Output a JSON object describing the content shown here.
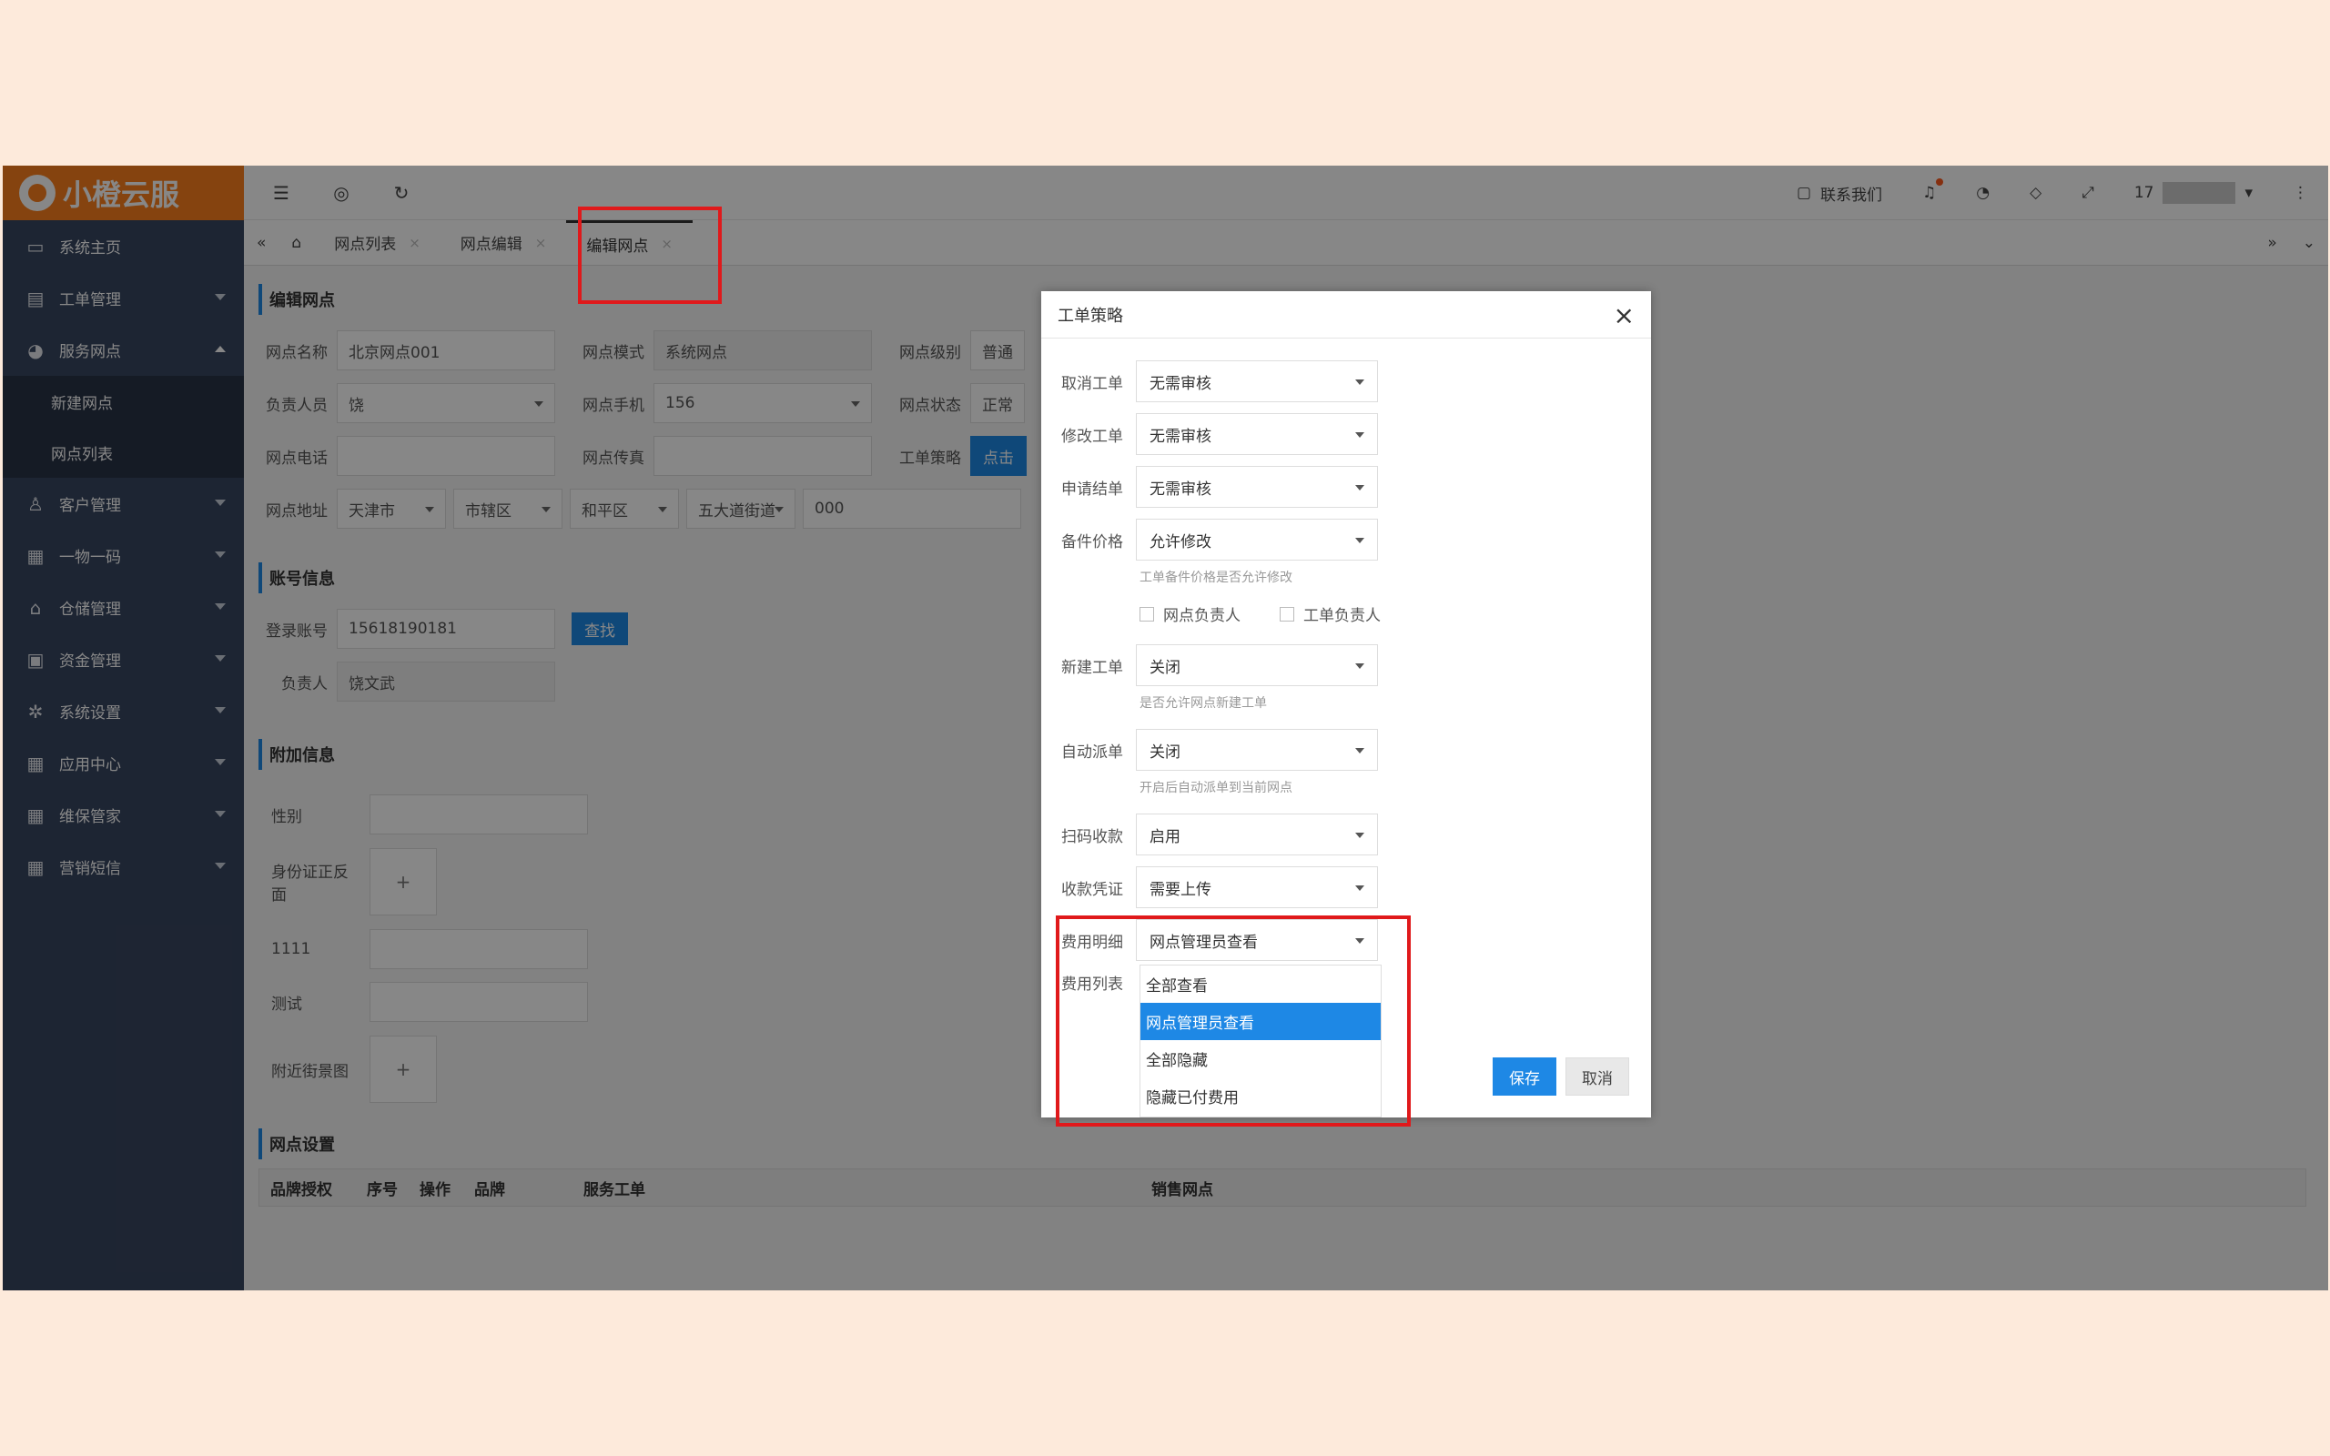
{
  "brand": {
    "name": "小橙云服",
    "color": "#fb7f1d"
  },
  "sidebar": {
    "items": [
      {
        "label": "系统主页",
        "icon": "monitor-icon"
      },
      {
        "label": "工单管理",
        "icon": "document-icon"
      },
      {
        "label": "服务网点",
        "icon": "globe-icon",
        "expanded": true,
        "children": [
          "新建网点",
          "网点列表"
        ]
      },
      {
        "label": "客户管理",
        "icon": "user-icon"
      },
      {
        "label": "一物一码",
        "icon": "grid-icon"
      },
      {
        "label": "仓储管理",
        "icon": "bank-icon"
      },
      {
        "label": "资金管理",
        "icon": "money-icon"
      },
      {
        "label": "系统设置",
        "icon": "gear-icon"
      },
      {
        "label": "应用中心",
        "icon": "grid-icon"
      },
      {
        "label": "维保管家",
        "icon": "grid-icon"
      },
      {
        "label": "营销短信",
        "icon": "grid-icon"
      }
    ]
  },
  "topbar": {
    "contact": "联系我们",
    "user": "17"
  },
  "tabs": [
    "网点列表",
    "网点编辑",
    "编辑网点"
  ],
  "form": {
    "section1": "编辑网点",
    "name_label": "网点名称",
    "name_value": "北京网点001",
    "mode_label": "网点模式",
    "mode_value": "系统网点",
    "level_label": "网点级别",
    "level_value": "普通",
    "owner_label": "负责人员",
    "owner_value": "饶",
    "phone_label": "网点手机",
    "phone_value": "156",
    "status_label": "网点状态",
    "status_value": "正常",
    "tel_label": "网点电话",
    "fax_label": "网点传真",
    "strategy_label": "工单策略",
    "strategy_btn": "点击",
    "addr_label": "网点地址",
    "addr_city": "天津市",
    "addr_district": "市辖区",
    "addr_area": "和平区",
    "addr_street": "五大道街道",
    "addr_detail": "000",
    "section2": "账号信息",
    "login_label": "登录账号",
    "login_value": "15618190181",
    "find_btn": "查找",
    "person_label": "负责人",
    "person_value": "饶文武",
    "section3": "附加信息",
    "gender_label": "性别",
    "idcard_label": "身份证正反面",
    "field1111_label": "1111",
    "test_label": "测试",
    "street_label": "附近街景图",
    "section4": "网点设置",
    "table_headers": [
      "品牌授权",
      "序号",
      "操作",
      "品牌",
      "服务工单",
      "销售网点"
    ]
  },
  "modal": {
    "title": "工单策略",
    "rows": [
      {
        "label": "取消工单",
        "value": "无需审核"
      },
      {
        "label": "修改工单",
        "value": "无需审核"
      },
      {
        "label": "申请结单",
        "value": "无需审核"
      },
      {
        "label": "备件价格",
        "value": "允许修改",
        "hint": "工单备件价格是否允许修改"
      },
      {
        "label": "新建工单",
        "value": "关闭",
        "hint": "是否允许网点新建工单"
      },
      {
        "label": "自动派单",
        "value": "关闭",
        "hint": "开启后自动派单到当前网点"
      },
      {
        "label": "扫码收款",
        "value": "启用"
      },
      {
        "label": "收款凭证",
        "value": "需要上传"
      },
      {
        "label": "费用明细",
        "value": "网点管理员查看"
      },
      {
        "label": "费用列表",
        "value": ""
      }
    ],
    "checkboxes": [
      "网点负责人",
      "工单负责人"
    ],
    "dropdown_options": [
      "全部查看",
      "网点管理员查看",
      "全部隐藏",
      "隐藏已付费用"
    ],
    "selected_option": "网点管理员查看",
    "save": "保存",
    "cancel": "取消"
  }
}
